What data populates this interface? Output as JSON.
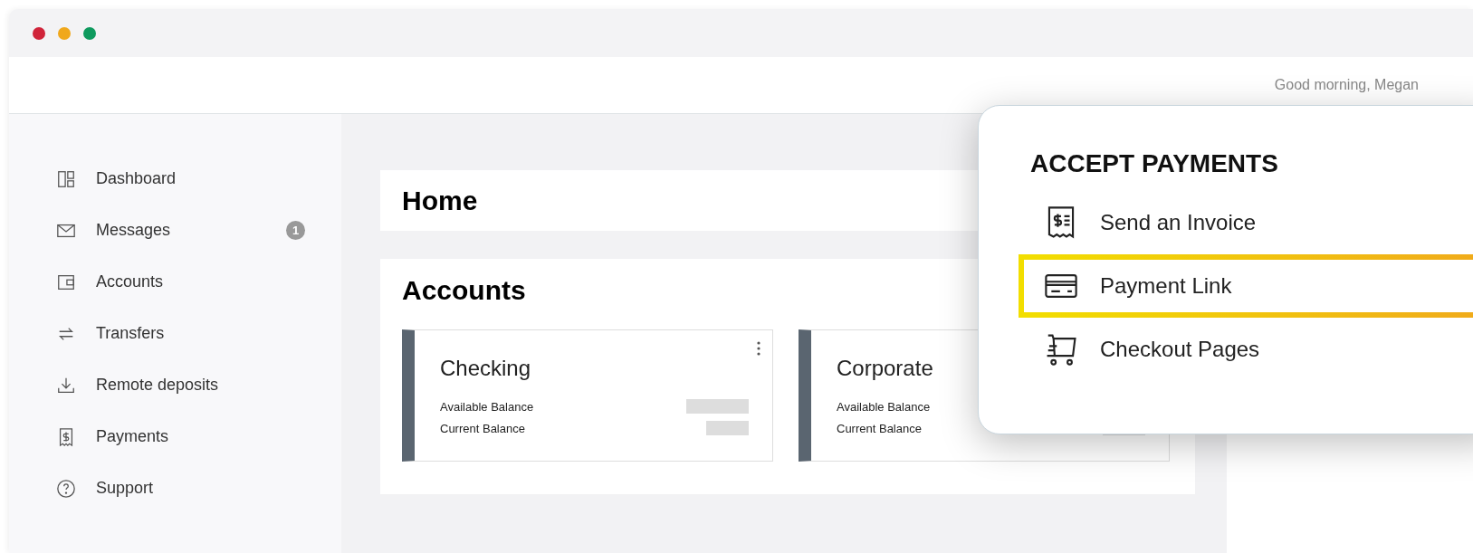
{
  "window": {
    "controls": [
      {
        "color": "#d0243a"
      },
      {
        "color": "#f0a81c"
      },
      {
        "color": "#0e9a5e"
      }
    ]
  },
  "header": {
    "greeting": "Good morning, Megan"
  },
  "sidebar": {
    "items": [
      {
        "label": "Dashboard",
        "kind": "dashboard"
      },
      {
        "label": "Messages",
        "kind": "mail",
        "badge": "1"
      },
      {
        "label": "Accounts",
        "kind": "wallet"
      },
      {
        "label": "Transfers",
        "kind": "transfer"
      },
      {
        "label": "Remote deposits",
        "kind": "download"
      },
      {
        "label": "Payments",
        "kind": "receipt"
      },
      {
        "label": "Support",
        "kind": "help"
      }
    ]
  },
  "page_title": "Home",
  "accounts": {
    "title": "Accounts",
    "cards": [
      {
        "name": "Checking",
        "has_menu": true,
        "rows": [
          {
            "label": "Available Balance"
          },
          {
            "label": "Current Balance"
          }
        ]
      },
      {
        "name": "Corporate",
        "rows": [
          {
            "label": "Available Balance"
          },
          {
            "label": "Current Balance"
          }
        ]
      }
    ]
  },
  "popup": {
    "title": "ACCEPT PAYMENTS",
    "items": [
      {
        "label": "Send an Invoice",
        "kind": "invoice",
        "selected": false
      },
      {
        "label": "Payment Link",
        "kind": "card",
        "selected": true
      },
      {
        "label": "Checkout Pages",
        "kind": "cart",
        "selected": false
      }
    ]
  }
}
